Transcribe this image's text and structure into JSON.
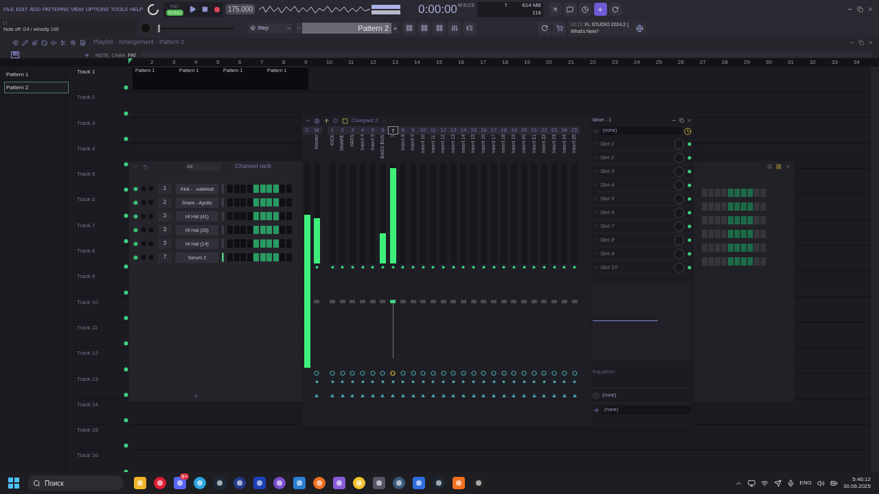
{
  "menu": [
    "FILE",
    "EDIT",
    "ADD",
    "PATTERNS",
    "VIEW",
    "OPTIONS",
    "TOOLS",
    "HELP"
  ],
  "modes": [
    {
      "label": "PAT",
      "selected": false
    },
    {
      "label": "SONG",
      "selected": true
    }
  ],
  "tempo": "175.000",
  "time": {
    "value": "0:00:00",
    "format": "M:S:CS"
  },
  "cpu": {
    "voices": "7",
    "memory": "614 MB",
    "polyphony": "116"
  },
  "hint": {
    "bracket": "[ ]",
    "text": "Note off: G4 / velocity 100"
  },
  "pitch_slider": {
    "level": 0
  },
  "snap": "Step",
  "pattern": "Pattern 2",
  "news": {
    "time": "02:12",
    "title": "FL STUDIO 2024.2 |",
    "link": "What's New?"
  },
  "playlist": {
    "title": "Playlist - Arrangement - Pattern 2",
    "tool_labels": [
      "NOTE",
      "CHAN",
      "PAT"
    ],
    "patterns": [
      {
        "name": "Pattern 1",
        "selected": false
      },
      {
        "name": "Pattern 2",
        "selected": true
      }
    ],
    "bars": [
      "2",
      "3",
      "4",
      "5",
      "6",
      "7",
      "8",
      "9",
      "10",
      "11",
      "12",
      "13",
      "14",
      "15",
      "16",
      "17",
      "18",
      "19",
      "20",
      "21",
      "22",
      "23",
      "24",
      "25",
      "26",
      "27",
      "28",
      "29",
      "30",
      "31",
      "32",
      "33",
      "34"
    ],
    "tracks": [
      {
        "name": "Track 1",
        "clips": [
          "Pattern 1",
          "Pattern 1",
          "Pattern 1",
          "Pattern 1"
        ]
      },
      {
        "name": "Track 2"
      },
      {
        "name": "Track 3"
      },
      {
        "name": "Track 4"
      },
      {
        "name": "Track 5"
      },
      {
        "name": "Track 6"
      },
      {
        "name": "Track 7"
      },
      {
        "name": "Track 8"
      },
      {
        "name": "Track 9"
      },
      {
        "name": "Track 10"
      },
      {
        "name": "Track 11"
      },
      {
        "name": "Track 12"
      },
      {
        "name": "Track 13"
      },
      {
        "name": "Track 14"
      },
      {
        "name": "Track 15"
      },
      {
        "name": "Track 16"
      }
    ]
  },
  "channel_rack": {
    "filter": "All",
    "title": "Channel rack",
    "channels": [
      {
        "number": "1",
        "name": "Kick - ..eakbeat",
        "selected": false,
        "steps": [
          false,
          false,
          false,
          false,
          true,
          true,
          true,
          true,
          false,
          false
        ]
      },
      {
        "number": "2",
        "name": "Snare - Apollo",
        "selected": false,
        "steps": [
          false,
          false,
          false,
          false,
          true,
          true,
          true,
          true,
          false,
          false
        ]
      },
      {
        "number": "3",
        "name": "Hi Hat (41)",
        "selected": false,
        "steps": [
          false,
          false,
          false,
          false,
          true,
          true,
          true,
          true,
          false,
          false
        ]
      },
      {
        "number": "3",
        "name": "Hi Hat (26)",
        "selected": false,
        "steps": [
          false,
          false,
          false,
          false,
          true,
          true,
          true,
          true,
          false,
          false
        ]
      },
      {
        "number": "3",
        "name": "Hi Hat (14)",
        "selected": false,
        "steps": [
          false,
          false,
          false,
          false,
          true,
          true,
          true,
          true,
          false,
          false
        ]
      },
      {
        "number": "7",
        "name": "Serum 2",
        "selected": true,
        "steps": [
          false,
          false,
          false,
          false,
          true,
          true,
          true,
          true,
          false,
          false
        ]
      }
    ]
  },
  "mixer": {
    "preset": "Compact 2",
    "current": {
      "label": "C",
      "level": 0.75
    },
    "strips": [
      {
        "number": "M",
        "name": "Master",
        "level": 0.45,
        "selected": false
      },
      {
        "number": "1",
        "name": "KICK",
        "selected": false
      },
      {
        "number": "2",
        "name": "SNARE",
        "selected": false
      },
      {
        "number": "3",
        "name": "HATS",
        "selected": false
      },
      {
        "number": "4",
        "name": "Insert 4",
        "selected": false
      },
      {
        "number": "5",
        "name": "Insert 5",
        "selected": false
      },
      {
        "number": "6",
        "name": "BASS BUS",
        "level": 0.3,
        "selected": false
      },
      {
        "number": "7",
        "name": "1",
        "level": 0.95,
        "selected": true
      },
      {
        "number": "8",
        "name": "Insert 8",
        "selected": false
      },
      {
        "number": "9",
        "name": "Insert 9",
        "selected": false
      },
      {
        "number": "10",
        "name": "Insert 10",
        "selected": false
      },
      {
        "number": "11",
        "name": "Insert 11",
        "selected": false
      },
      {
        "number": "12",
        "name": "Insert 12",
        "selected": false
      },
      {
        "number": "13",
        "name": "Insert 13",
        "selected": false
      },
      {
        "number": "14",
        "name": "Insert 14",
        "selected": false
      },
      {
        "number": "15",
        "name": "Insert 15",
        "selected": false
      },
      {
        "number": "16",
        "name": "Insert 16",
        "selected": false
      },
      {
        "number": "17",
        "name": "Insert 17",
        "selected": false
      },
      {
        "number": "18",
        "name": "Insert 18",
        "selected": false
      },
      {
        "number": "19",
        "name": "Insert 19",
        "selected": false
      },
      {
        "number": "20",
        "name": "Insert 20",
        "selected": false
      },
      {
        "number": "21",
        "name": "Insert 21",
        "selected": false
      },
      {
        "number": "22",
        "name": "Insert 22",
        "selected": false
      },
      {
        "number": "23",
        "name": "Insert 23",
        "selected": false
      },
      {
        "number": "24",
        "name": "Insert 24",
        "selected": false
      },
      {
        "number": "25",
        "name": "Insert 25",
        "selected": false
      }
    ],
    "panel": {
      "title": "Mixer - 1",
      "input": "(none)",
      "slots": [
        {
          "name": "Slot 1",
          "on": true
        },
        {
          "name": "Slot 2",
          "on": true
        },
        {
          "name": "Slot 3",
          "on": true
        },
        {
          "name": "Slot 4",
          "on": true
        },
        {
          "name": "Slot 5",
          "on": true
        },
        {
          "name": "Slot 6",
          "on": true
        },
        {
          "name": "Slot 7",
          "on": true
        },
        {
          "name": "Slot 8",
          "on": true
        },
        {
          "name": "Slot 9",
          "on": true
        },
        {
          "name": "Slot 10",
          "on": true
        }
      ],
      "eq_label": "Equalizer",
      "send": "(none)",
      "output": "(none)"
    }
  },
  "taskbar": {
    "search": "Поиск",
    "badge": "9+",
    "language": "ENG",
    "time": "5:46:12",
    "date": "30.06.2025"
  }
}
